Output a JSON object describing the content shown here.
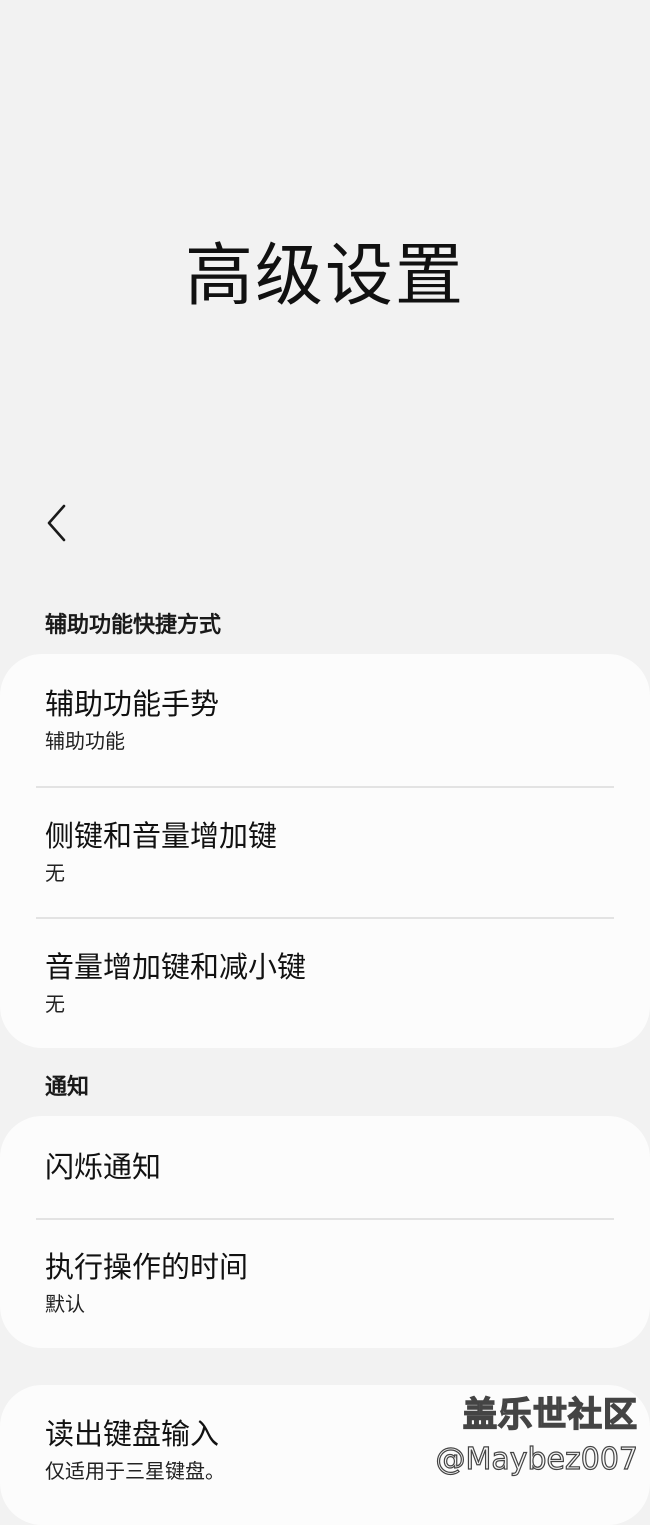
{
  "header": {
    "title": "高级设置",
    "back_icon": "chevron-left-icon"
  },
  "sections": [
    {
      "label": "辅助功能快捷方式",
      "items": [
        {
          "title": "辅助功能手势",
          "subtitle": "辅助功能"
        },
        {
          "title": "侧键和音量增加键",
          "subtitle": "无"
        },
        {
          "title": "音量增加键和减小键",
          "subtitle": "无"
        }
      ]
    },
    {
      "label": "通知",
      "items": [
        {
          "title": "闪烁通知"
        },
        {
          "title": "执行操作的时间",
          "subtitle": "默认"
        }
      ]
    },
    {
      "items": [
        {
          "title": "读出键盘输入",
          "subtitle": "仅适用于三星键盘。"
        }
      ]
    }
  ],
  "watermark": {
    "logo": "盖乐世社区",
    "handle": "@Maybez007"
  },
  "colors": {
    "background": "#f2f2f2",
    "card": "#fcfcfc",
    "divider": "#e3e3e3",
    "text": "#111111"
  }
}
